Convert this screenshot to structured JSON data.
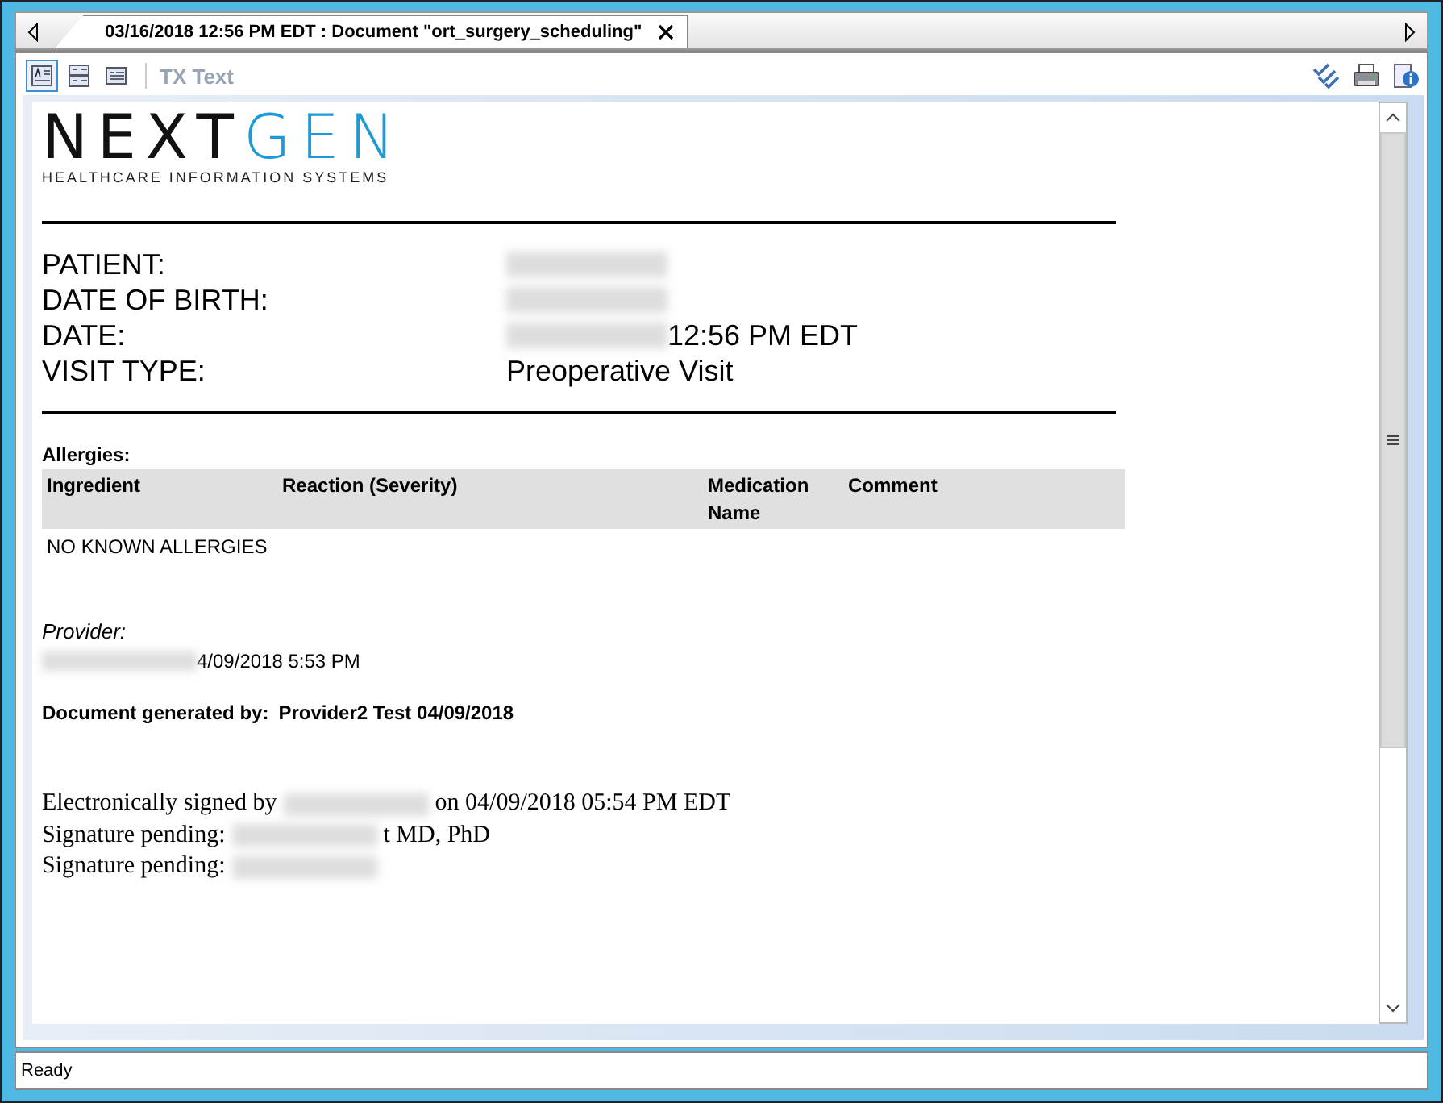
{
  "tab": {
    "title": "03/16/2018 12:56 PM EDT : Document \"ort_surgery_scheduling\"",
    "selected": true
  },
  "toolbar": {
    "buttons": [
      {
        "selected": true
      },
      {
        "selected": false
      },
      {
        "selected": false
      }
    ],
    "label": "TX Text"
  },
  "document": {
    "logo": {
      "dark": "NEXT",
      "accent": "GEN",
      "tagline": "HEALTHCARE INFORMATION SYSTEMS"
    },
    "header_fields": [
      {
        "label": "PATIENT:",
        "redacted": true
      },
      {
        "label": "DATE OF BIRTH:",
        "redacted": true
      },
      {
        "label": "DATE:",
        "redacted": true,
        "value": "12:56 PM EDT"
      },
      {
        "label": "VISIT TYPE:",
        "redacted": false,
        "value": "Preoperative Visit"
      }
    ],
    "allergies": {
      "title": "Allergies:",
      "columns": [
        "Ingredient",
        "Reaction (Severity)",
        "Medication Name",
        "Comment"
      ],
      "rows": [
        [
          "NO KNOWN ALLERGIES"
        ]
      ]
    },
    "provider": {
      "label": "Provider:",
      "redacted": true,
      "value": "4/09/2018 5:53 PM"
    },
    "generated": {
      "label": "Document generated by:",
      "value": "Provider2 Test  04/09/2018"
    },
    "signatures": [
      {
        "before": "Electronically signed by",
        "redacted": true,
        "after": "on 04/09/2018 05:54 PM EDT"
      },
      {
        "before": "Signature pending:",
        "redacted": true,
        "after": "t MD, PhD"
      },
      {
        "before": "Signature pending:",
        "redacted": true
      }
    ]
  },
  "status_bar": {
    "text": "Ready"
  }
}
